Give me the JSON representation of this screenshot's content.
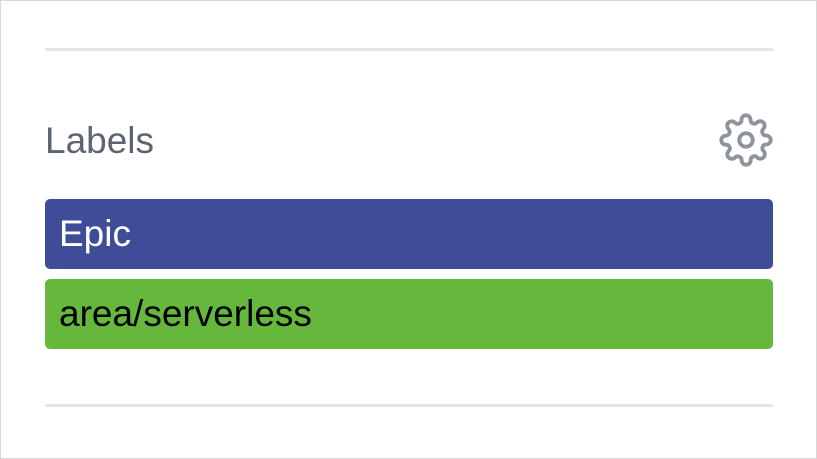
{
  "labels_section": {
    "title": "Labels",
    "settings_icon": "gear-icon",
    "items": [
      {
        "name": "Epic",
        "background": "#3f4d99",
        "text_color": "#ffffff"
      },
      {
        "name": "area/serverless",
        "background": "#65b83b",
        "text_color": "#000000"
      }
    ]
  },
  "colors": {
    "divider": "#e4e5e9",
    "title_text": "#5d6472",
    "icon": "#8e939e"
  }
}
